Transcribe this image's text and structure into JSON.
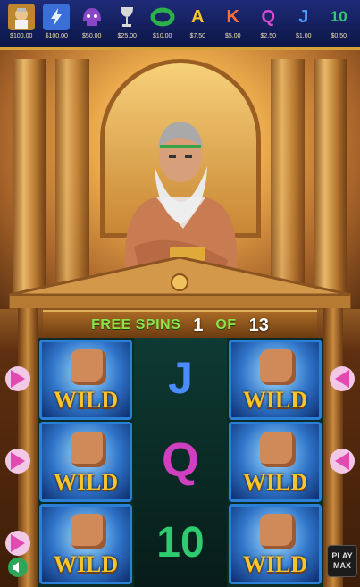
{
  "paytable": {
    "items": [
      {
        "symbol": "zeus-portrait",
        "value": "$100.00",
        "color": "#c0862e"
      },
      {
        "symbol": "lightning",
        "value": "$100.00",
        "color": "#3a6fd8"
      },
      {
        "symbol": "helmet",
        "value": "$50.00",
        "color": "#7b3fb4"
      },
      {
        "symbol": "chalice",
        "value": "$25.00",
        "color": "#b7b7b7"
      },
      {
        "symbol": "laurel",
        "value": "$10.00",
        "color": "#2bb04a"
      },
      {
        "symbol": "A",
        "value": "$7.50",
        "color": "#f3c629"
      },
      {
        "symbol": "K",
        "value": "$5.00",
        "color": "#ff6f3a"
      },
      {
        "symbol": "Q",
        "value": "$2.50",
        "color": "#d64ad0"
      },
      {
        "symbol": "J",
        "value": "$1.00",
        "color": "#4a9bff"
      },
      {
        "symbol": "10",
        "value": "$0.50",
        "color": "#2ecc71"
      }
    ]
  },
  "banner": {
    "free_spins_label": "FREE SPINS",
    "current": "1",
    "of_label": "OF",
    "total": "13"
  },
  "reels": {
    "reel1": [
      "WILD",
      "WILD",
      "WILD"
    ],
    "reel2": [
      {
        "symbol": "J",
        "color": "#4a8cff"
      },
      {
        "symbol": "Q",
        "color": "#d13fc1"
      },
      {
        "symbol": "10",
        "color": "#2ecc71"
      }
    ],
    "reel3": [
      "WILD",
      "WILD",
      "WILD"
    ]
  },
  "controls": {
    "play_max_line1": "PLAY",
    "play_max_line2": "MAX"
  }
}
